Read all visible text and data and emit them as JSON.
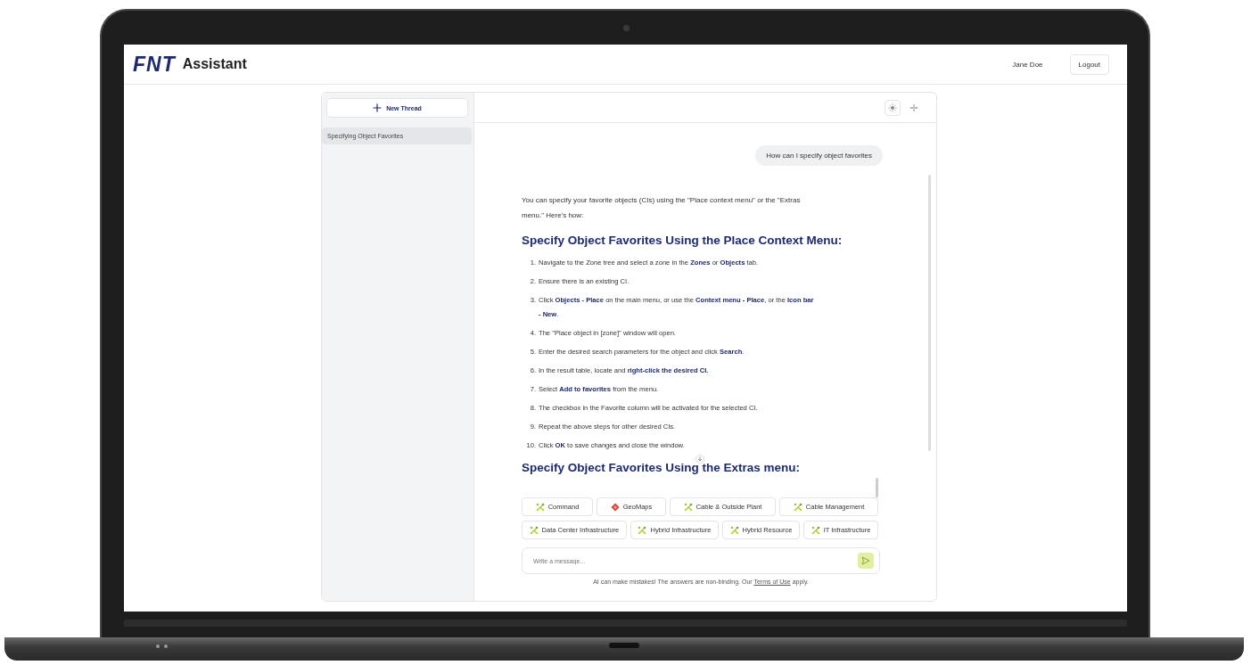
{
  "header": {
    "logo_mark": "FNT",
    "logo_text": "Assistant",
    "user_name": "Jane Doe",
    "logout_button": "Logout"
  },
  "sidebar": {
    "new_thread_button": "New Thread",
    "threads": [
      {
        "label": "Specifying Object Favorites",
        "selected": true
      }
    ]
  },
  "chat": {
    "messages": [
      {
        "kind": "user",
        "text": "How can I specify object favorites"
      },
      {
        "kind": "assistant",
        "intro": "You can specify your favorite objects (CIs) using the \"Place context menu\" or the \"Extras menu.\" Here's how:",
        "heading": "Specify Object Favorites Using the Place Context Menu:",
        "steps": [
          {
            "number": "1.",
            "text": "Navigate to the Zone tree and select a zone in the **Zones** or **Objects** tab."
          },
          {
            "number": "2.",
            "text": "Ensure there is an existing CI."
          },
          {
            "number": "3.",
            "text": "Click **Objects - Place** on the main menu, or use the **Context menu - Place**, or the **Icon bar - New**."
          },
          {
            "number": "4.",
            "text": "The \"Place object in [zone]\" window will open."
          },
          {
            "number": "5.",
            "text": "Enter the desired search parameters for the object and click **Search**."
          },
          {
            "number": "6.",
            "text": "In the result table, locate and **right-click the desired CI.**"
          },
          {
            "number": "7.",
            "text": "Select **Add to favorites** from the menu."
          },
          {
            "number": "8.",
            "text": "The checkbox in the Favorite column will be activated for the selected CI."
          },
          {
            "number": "9.",
            "text": "Repeat the above steps for other desired CIs."
          },
          {
            "number": "10.",
            "text": "Click **OK** to save changes and close the window."
          }
        ],
        "heading_2": "Specify Object Favorites Using the Extras menu:"
      }
    ],
    "chips": [
      {
        "label": "Command",
        "kind": "network"
      },
      {
        "label": "GeoMaps",
        "kind": "diamond"
      },
      {
        "label": "Cable & Outside Plant",
        "kind": "network"
      },
      {
        "label": "Cable Management",
        "kind": "network"
      },
      {
        "label": "Data Center Infrastructure",
        "kind": "network"
      },
      {
        "label": "Hybrid Infrastructure",
        "kind": "network"
      },
      {
        "label": "Hybrid Resource",
        "kind": "network"
      },
      {
        "label": "IT Infrastructure",
        "kind": "network"
      }
    ],
    "input": {
      "placeholder": "Write a message..."
    },
    "disclaimer": "AI can make mistakes! The answers are non-binding. Our ",
    "terms_link": "Terms of Use",
    "disclaimer_end": " apply."
  }
}
